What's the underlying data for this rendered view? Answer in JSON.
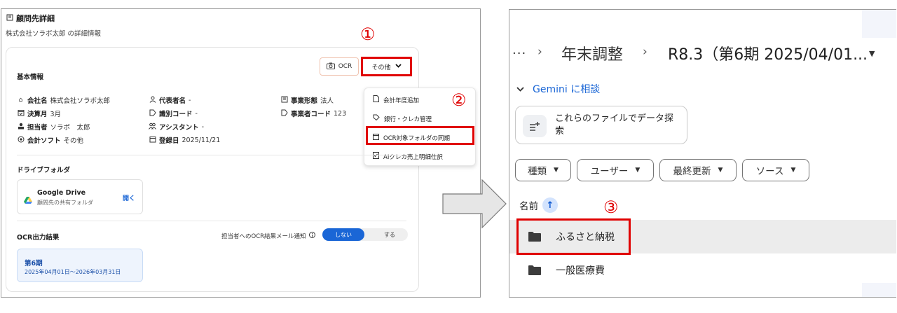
{
  "left": {
    "title": "顧問先詳細",
    "subtitle": "株式会社ソラボ太郎 の詳細情報",
    "basic_title": "基本情報",
    "ocr_button": "OCR",
    "other_button": "その他",
    "markers": {
      "m1": "①",
      "m2": "②",
      "m3": "③"
    },
    "info": {
      "company_label": "会社名",
      "company_value": "株式会社ソラボ太郎",
      "rep_label": "代表者名",
      "rep_value": "-",
      "form_label": "事業形態",
      "form_value": "法人",
      "fiscal_label": "決算月",
      "fiscal_value": "3月",
      "id_label": "識別コード",
      "id_value": "-",
      "biz_label": "事業者コード",
      "biz_value": "123",
      "staff_label": "担当者",
      "staff_value": "ソラボ　太郎",
      "assist_label": "アシスタント",
      "assist_value": "-",
      "soft_label": "会計ソフト",
      "soft_value": "その他",
      "reg_label": "登録日",
      "reg_value": "2025/11/21"
    },
    "menu": {
      "item1": "会計年度追加",
      "item2": "銀行・クレカ管理",
      "item3": "OCR対象フォルダの同期",
      "item4": "AIクレカ売上明細仕訳"
    },
    "drive_title": "ドライブフォルダ",
    "drive_card_title": "Google Drive",
    "drive_card_sub": "顧問先の共有フォルダ",
    "drive_open": "開く",
    "ocr_title": "OCR出力結果",
    "notify_label": "担当者へのOCR結果メール通知",
    "toggle_on": "しない",
    "toggle_off": "する",
    "period_title": "第6期",
    "period_range": "2025年04月01日〜2026年03月31日"
  },
  "right": {
    "bc_more": "···",
    "bc_item1": "年末調整",
    "bc_item2": "R8.3（第6期 2025/04/01...",
    "gemini_label": "Gemini に相談",
    "suggest_text": "これらのファイルでデータ探索",
    "chips": {
      "type": "種類",
      "user": "ユーザー",
      "modified": "最終更新",
      "source": "ソース"
    },
    "name_header": "名前",
    "rows": {
      "row1": "ふるさと納税",
      "row2": "一般医療費"
    }
  },
  "colors": {
    "accent_red": "#e00000",
    "drive_blue": "#1a66d6"
  }
}
